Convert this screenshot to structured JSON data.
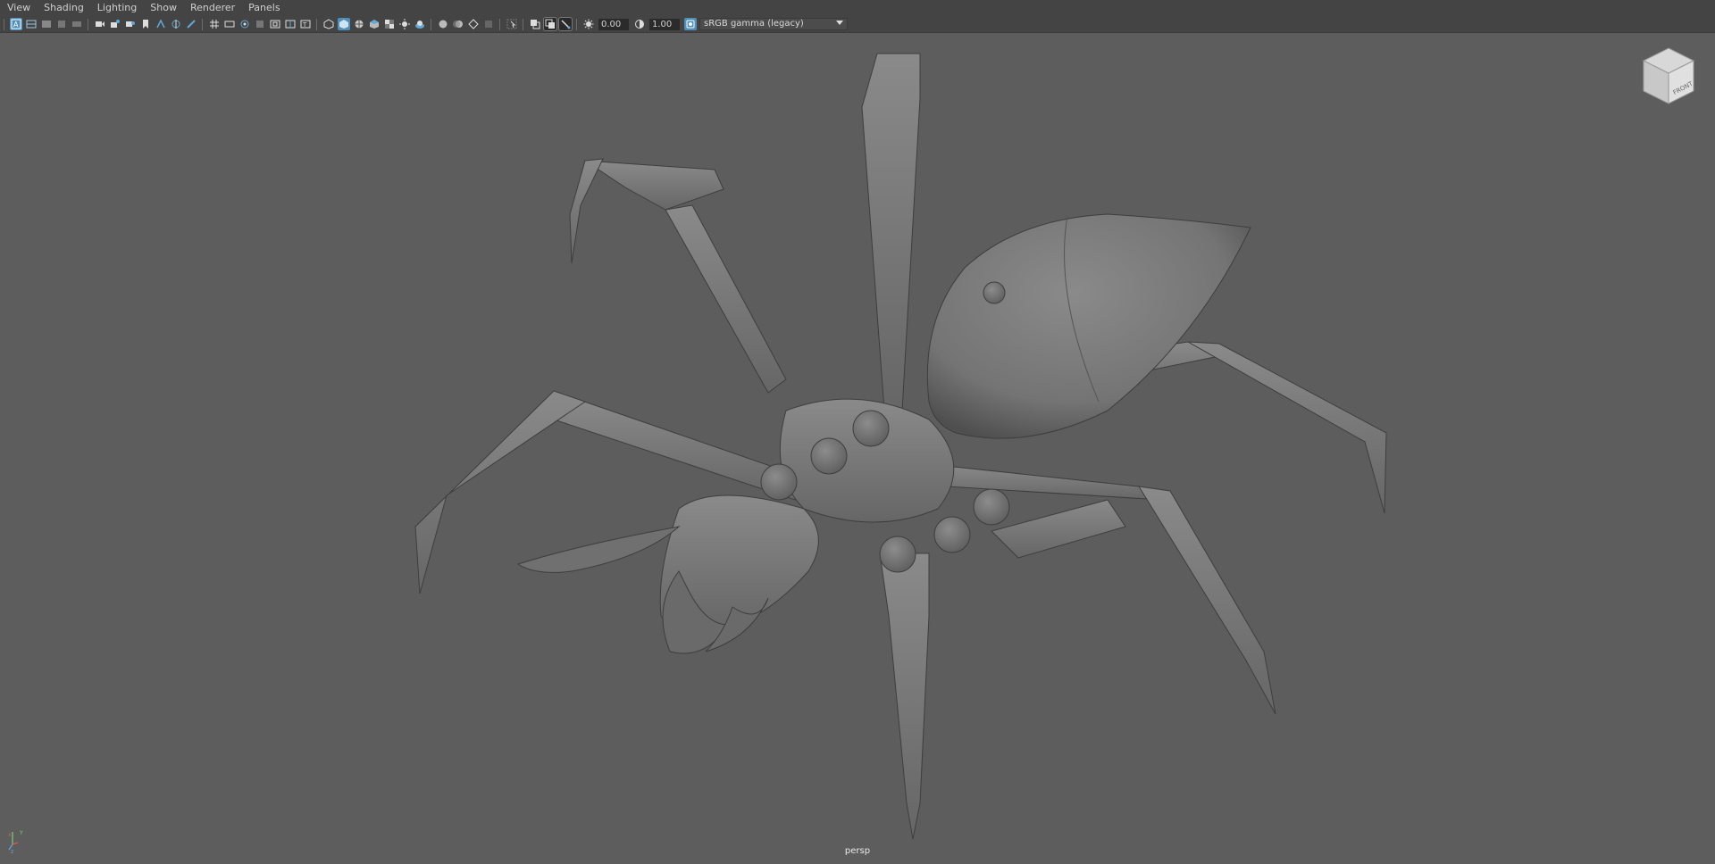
{
  "menubar": {
    "items": [
      "View",
      "Shading",
      "Lighting",
      "Show",
      "Renderer",
      "Panels"
    ]
  },
  "toolbar": {
    "exposure_value": "0.00",
    "gamma_value": "1.00",
    "color_space": "sRGB gamma (legacy)",
    "icons": [
      "select-camera-icon",
      "camera-attributes-icon",
      "bookmarks-icon",
      "image-plane-icon",
      "grease-pencil-icon",
      "camera-icon",
      "lock-camera-icon",
      "snapshot-icon",
      "bookmark-icon",
      "2d-pan-zoom-icon",
      "pan-icon",
      "pencil-icon",
      "grid-icon",
      "film-gate-icon",
      "resolution-gate-icon",
      "gate-mask-icon",
      "field-chart-icon",
      "safe-action-icon",
      "safe-title-icon",
      "wireframe-icon",
      "smooth-shade-icon",
      "wireframe-on-shaded-icon",
      "default-material-icon",
      "textured-icon",
      "use-lights-icon",
      "shadows-icon",
      "screen-space-ao-icon",
      "motion-blur-icon",
      "anti-alias-icon",
      "depth-of-field-icon",
      "isolate-select-icon",
      "xray-icon",
      "xray-joints-icon",
      "xray-components-icon"
    ]
  },
  "viewport": {
    "camera_label": "persp",
    "background_color": "#5d5d5d",
    "model_color": "#7a7a7a",
    "accent_color": "#4f8fba"
  },
  "viewcube": {
    "face_label": "FRONT"
  }
}
